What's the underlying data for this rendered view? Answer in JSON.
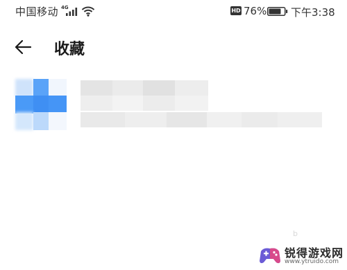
{
  "status_bar": {
    "carrier": "中国移动",
    "network_type": "4G",
    "hd_badge": "HD",
    "battery_percent": "76%",
    "time": "下午3:38",
    "icons": [
      "signal-icon",
      "wifi-icon",
      "battery-icon"
    ]
  },
  "header": {
    "back_icon": "arrow-left-icon",
    "title": "收藏"
  },
  "favorites": {
    "items": [
      {
        "title": "",
        "subtitle": "",
        "thumbnail_accent": "#4a9af7"
      }
    ]
  },
  "watermark": {
    "small_text": "b",
    "brand_cn": "锐得游戏网",
    "url": "www.ytruido.com",
    "logo_colors": [
      "#6b5bd6",
      "#d84a8a"
    ]
  },
  "colors": {
    "background": "#ffffff",
    "text_primary": "#1a1a1a",
    "blur_gray": "#e9e9e9",
    "accent_blue": "#4a9af7"
  }
}
